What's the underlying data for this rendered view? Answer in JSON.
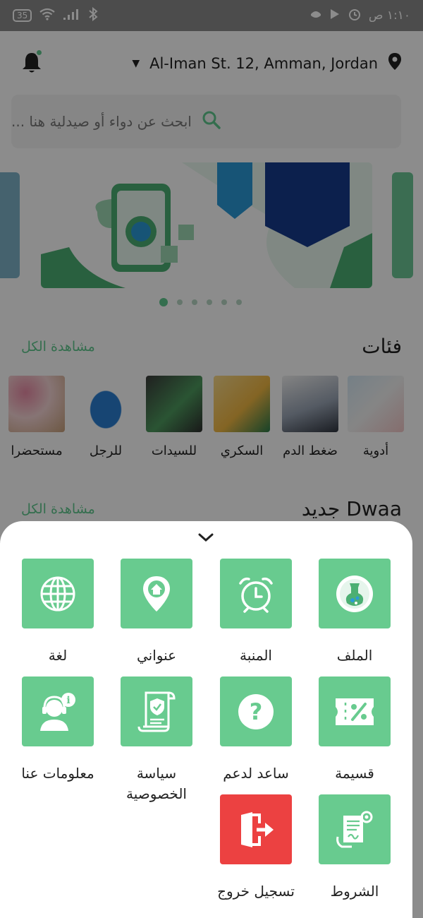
{
  "status_bar": {
    "battery": "35",
    "time": "١:١٠ ص"
  },
  "header": {
    "address": "Al-Iman St. 12, Amman, Jordan",
    "icons": [
      "notification-bell-icon",
      "location-pin-icon",
      "dropdown-caret-icon"
    ]
  },
  "search": {
    "placeholder": "ابحث عن دواء أو صيدلية هنا ..."
  },
  "banner": {
    "dots_count": 6,
    "active_dot": 0
  },
  "categories_section": {
    "title": "فئات",
    "see_all": "مشاهدة الكل",
    "items": [
      {
        "label": "أدوية"
      },
      {
        "label": "ضغط الدم"
      },
      {
        "label": "السكري"
      },
      {
        "label": "للسيدات"
      },
      {
        "label": "للرجل"
      },
      {
        "label": "مستحضرا"
      }
    ]
  },
  "new_section": {
    "title": "جديد Dwaa",
    "see_all": "مشاهدة الكل"
  },
  "menu_sheet": {
    "items": [
      {
        "label": "الملف",
        "icon": "profile-logo-icon"
      },
      {
        "label": "المنبة",
        "icon": "alarm-clock-icon"
      },
      {
        "label": "عنواني",
        "icon": "home-location-icon"
      },
      {
        "label": "لغة",
        "icon": "globe-icon"
      },
      {
        "label": "قسيمة",
        "icon": "coupon-percent-icon"
      },
      {
        "label": "ساعد لدعم",
        "icon": "help-question-icon"
      },
      {
        "label": "سياسة الخصوصية",
        "icon": "privacy-document-icon"
      },
      {
        "label": "معلومات عنا",
        "icon": "support-agent-icon"
      },
      {
        "label": "الشروط",
        "icon": "terms-document-icon"
      },
      {
        "label": "تسجيل خروج",
        "icon": "logout-door-icon"
      }
    ],
    "colors": {
      "tile": "#68cb8f",
      "logout": "#ec4141",
      "accent": "#5fc98e"
    }
  }
}
